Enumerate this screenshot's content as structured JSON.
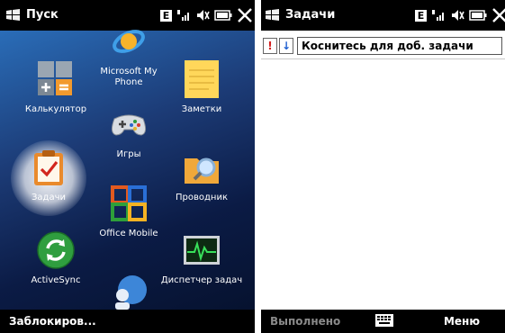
{
  "left": {
    "title": "Пуск",
    "status": {
      "connection": "E"
    },
    "tiles": [
      {
        "label": "Microsoft My Phone"
      },
      {
        "label": "Калькулятор"
      },
      {
        "label": "Заметки"
      },
      {
        "label": "Игры"
      },
      {
        "label": "Задачи"
      },
      {
        "label": "Проводник"
      },
      {
        "label": "Office Mobile"
      },
      {
        "label": "ActiveSync"
      },
      {
        "label": "Диспетчер задач"
      }
    ],
    "softkey_left": "Заблокиров..."
  },
  "right": {
    "title": "Задачи",
    "status": {
      "connection": "E"
    },
    "priority_marks": {
      "high": "!",
      "low": "↓"
    },
    "new_task_placeholder": "Коснитесь для доб. задачи",
    "softkey_left": "Выполнено",
    "softkey_right": "Меню"
  },
  "colors": {
    "accent": "#1c3b76",
    "highlight": "#ffffff",
    "titlebar": "#000000"
  }
}
